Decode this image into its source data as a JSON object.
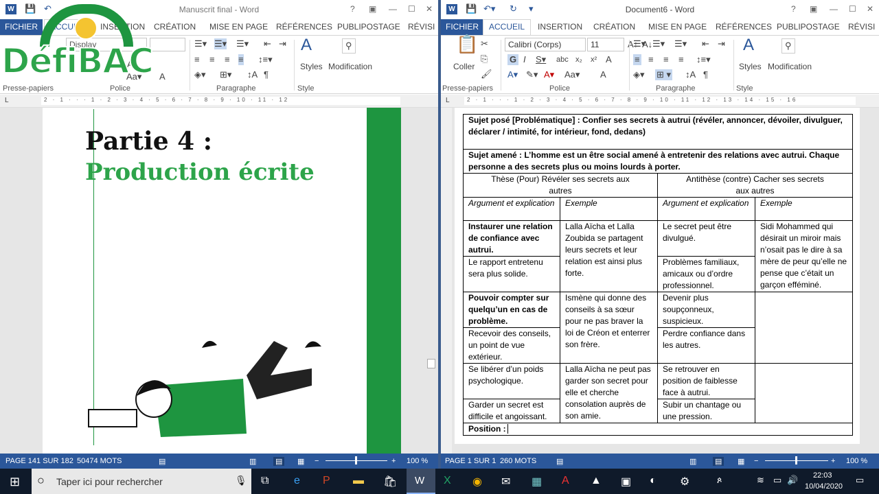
{
  "left": {
    "title": "Manuscrit final - Word",
    "tabs": [
      "FICHIER",
      "ACCUEIL",
      "INSERTION",
      "CRÉATION",
      "MISE EN PAGE",
      "RÉFÉRENCES",
      "PUBLIPOSTAGE",
      "RÉVISI"
    ],
    "font_name": "Display",
    "groups": [
      "Presse-papiers",
      "Police",
      "Paragraphe",
      "Style"
    ],
    "styles_label": "Styles",
    "modif_label": "Modification",
    "page_heading": "Partie 4 :",
    "page_subheading": "Production écrite",
    "status_page": "PAGE 141 SUR 182",
    "status_words": "50474 MOTS",
    "zoom": "100 %",
    "ruler": "2 · 1 · · · 1 · 2 · 3 · 4 · 5 · 6 · 7 · 8 · 9 · 10 · 11 · 12"
  },
  "right": {
    "title": "Document6 - Word",
    "tabs": [
      "FICHIER",
      "ACCUEIL",
      "INSERTION",
      "CRÉATION",
      "MISE EN PAGE",
      "RÉFÉRENCES",
      "PUBLIPOSTAGE",
      "RÉVISI"
    ],
    "font_name": "Calibri (Corps)",
    "font_size": "11",
    "paste_label": "Coller",
    "groups": [
      "Presse-papiers",
      "Police",
      "Paragraphe",
      "Style"
    ],
    "styles_label": "Styles",
    "modif_label": "Modification",
    "status_page": "PAGE 1 SUR 1",
    "status_words": "260 MOTS",
    "zoom": "100 %",
    "ruler": "2 · 1 · · · 1 · 2 · 3 · 4 · 5 · 6 · 7 · 8 · 9 · 10 · 11 · 12 · 13 · 14 · 15 · 16"
  },
  "logo": "DéfiBAC",
  "table": {
    "sujet_pose": "Sujet posé [Problématique] : Confier ses secrets à autrui (révéler, annoncer, dévoiler, divulguer, déclarer / intimité, for intérieur, fond, dedans)",
    "sujet_amene": "Sujet amené : L’homme est un être social amené à entretenir des relations avec autrui. Chaque personne a des secrets plus ou moins lourds à porter.",
    "these": "Thèse (Pour) Révéler ses secrets aux autres",
    "antithese": "Antithèse (contre) Cacher ses secrets aux autres",
    "h_arg": "Argument et explication",
    "h_ex": "Exemple",
    "r1_arg_bold": "Instaurer une relation de confiance avec autrui.",
    "r1_arg": "Le rapport entretenu sera plus solide.",
    "r1_ex": "Lalla Aïcha et Lalla Zoubida se partagent leurs secrets et leur relation est ainsi plus forte.",
    "r1_anti1": "Le secret peut être divulgué.",
    "r1_anti2": "Problèmes familiaux, amicaux ou d’ordre professionnel.",
    "r1_anti_ex": "Sidi Mohammed qui désirait un miroir mais n’osait pas le dire à sa mère de peur qu’elle ne pense que c’était un garçon efféminé.",
    "r2_arg_bold": "Pouvoir compter sur quelqu’un en cas de problème.",
    "r2_arg": "Recevoir des conseils, un point de vue extérieur.",
    "r2_ex": "Ismène qui donne des conseils à sa sœur pour ne pas braver la loi de Créon et enterrer son frère.",
    "r2_anti1": "Devenir plus soupçonneux, suspicieux.",
    "r2_anti2": "Perdre confiance dans les autres.",
    "r3_arg1": "Se libérer d’un poids psychologique.",
    "r3_arg2": "Garder un secret est difficile et angoissant.",
    "r3_ex": "Lalla Aïcha ne peut pas garder son secret pour elle et cherche consolation auprès de son amie.",
    "r3_anti1": "Se retrouver en position de faiblesse face à autrui.",
    "r3_anti2": "Subir un chantage ou une pression.",
    "position": "Position :"
  },
  "taskbar": {
    "search": "Taper ici pour rechercher",
    "time": "22:03",
    "date": "10/04/2020"
  }
}
